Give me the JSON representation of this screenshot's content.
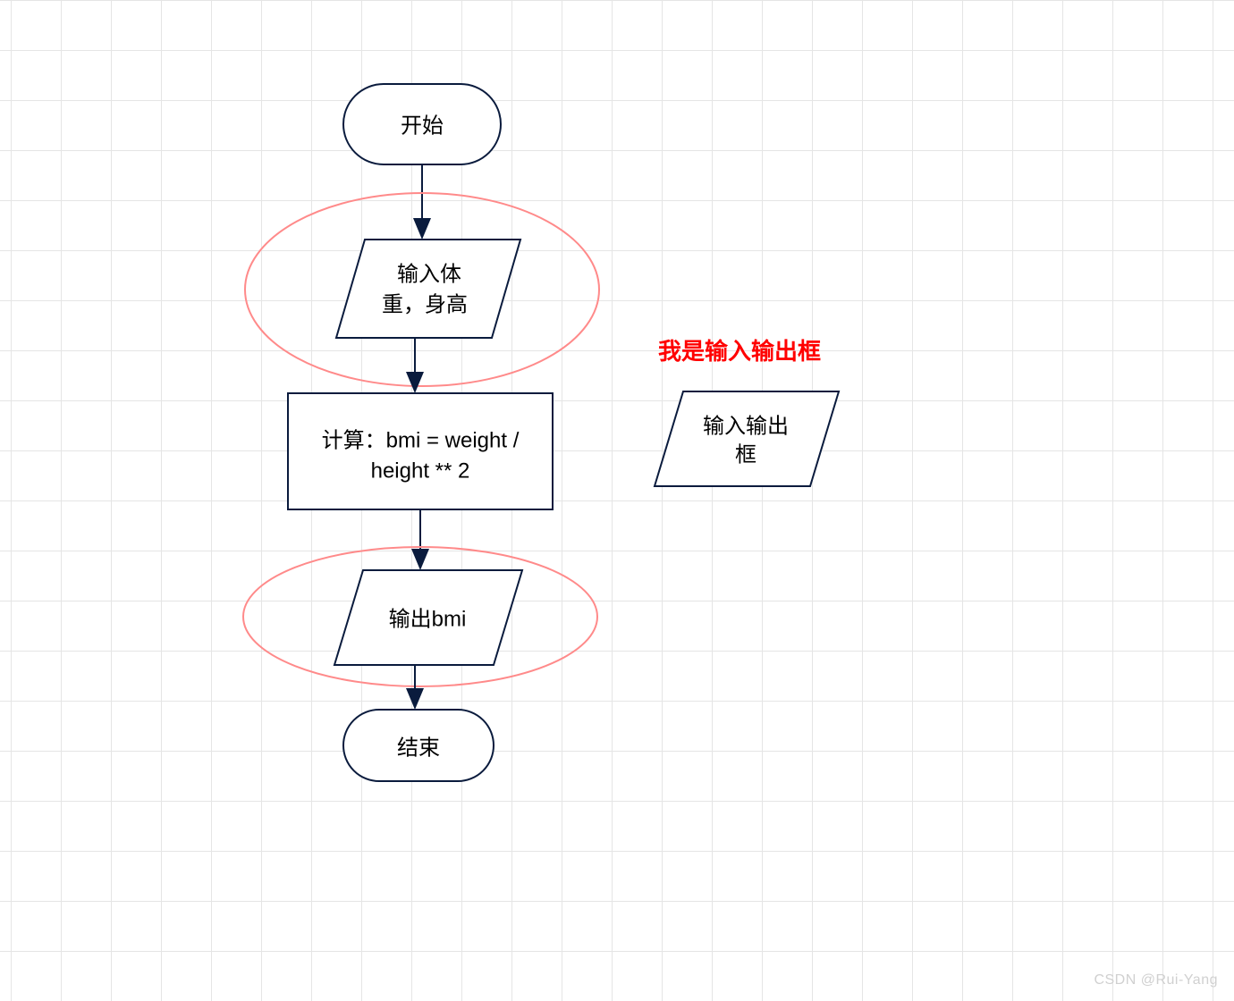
{
  "flowchart": {
    "start": "开始",
    "input": {
      "line1": "输入体",
      "line2": "重，身高"
    },
    "process": {
      "line1": "计算：bmi = weight /",
      "line2": "height ** 2"
    },
    "output": "输出bmi",
    "end": "结束"
  },
  "legend": {
    "label": "我是输入输出框",
    "box": {
      "line1": "输入输出",
      "line2": "框"
    }
  },
  "watermark": "CSDN @Rui-Yang"
}
